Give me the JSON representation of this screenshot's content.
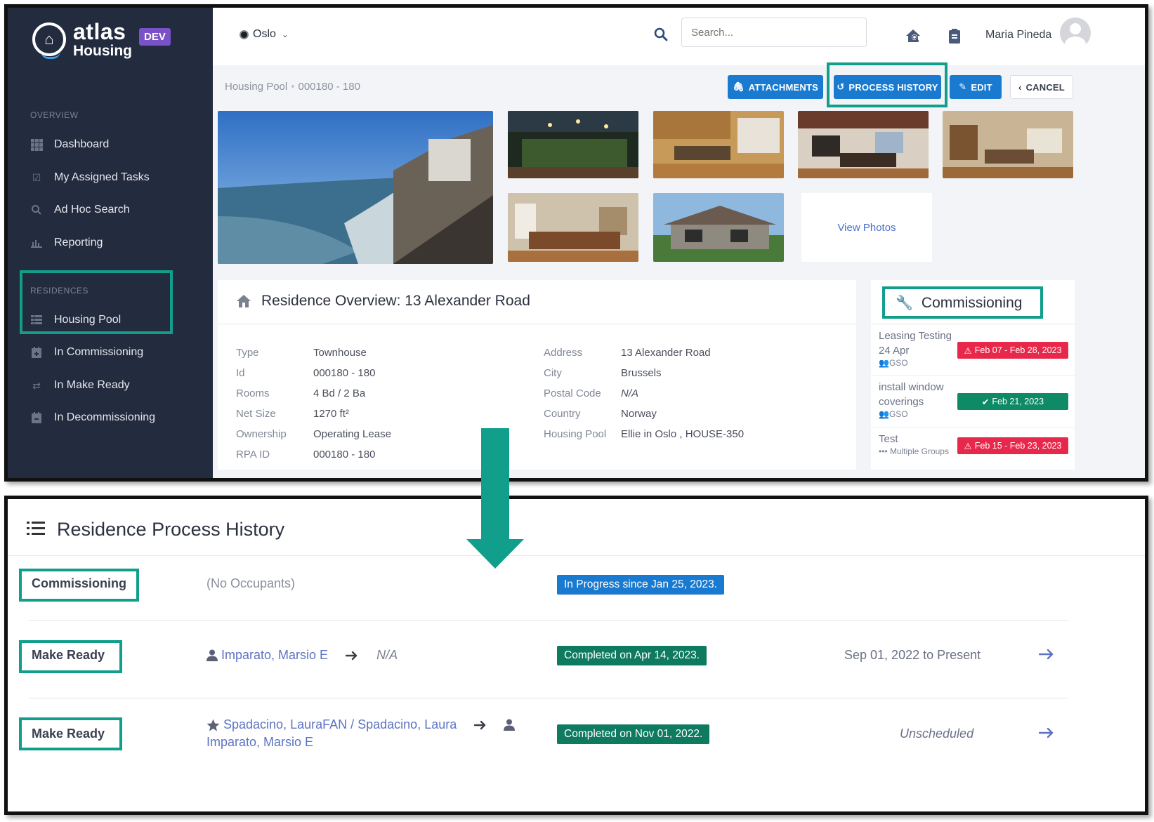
{
  "app": {
    "logo_line1": "atlas",
    "logo_line2": "Housing",
    "env_badge": "DEV"
  },
  "sidebar": {
    "overview_label": "OVERVIEW",
    "residences_label": "RESIDENCES",
    "overview_items": [
      {
        "label": "Dashboard",
        "icon": "grid-icon"
      },
      {
        "label": "My Assigned Tasks",
        "icon": "check-square-icon"
      },
      {
        "label": "Ad Hoc Search",
        "icon": "search-icon"
      },
      {
        "label": "Reporting",
        "icon": "bar-chart-icon"
      }
    ],
    "residence_items": [
      {
        "label": "Housing Pool",
        "icon": "list-icon"
      },
      {
        "label": "In Commissioning",
        "icon": "calendar-plus-icon"
      },
      {
        "label": "In Make Ready",
        "icon": "refresh-icon"
      },
      {
        "label": "In Decommissioning",
        "icon": "calendar-minus-icon"
      }
    ]
  },
  "topbar": {
    "city": "Oslo",
    "search_placeholder": "Search...",
    "user_name": "Maria Pineda"
  },
  "breadcrumb": {
    "root": "Housing Pool",
    "separator": "•",
    "current": "000180 - 180"
  },
  "actions": {
    "attachments": "ATTACHMENTS",
    "process_history": "PROCESS HISTORY",
    "edit": "EDIT",
    "cancel": "CANCEL"
  },
  "photos": {
    "view_photos": "View Photos"
  },
  "overview": {
    "title": "Residence Overview: 13 Alexander Road",
    "left": [
      {
        "key": "Type",
        "value": "Townhouse"
      },
      {
        "key": "Id",
        "value": "000180 - 180"
      },
      {
        "key": "Rooms",
        "value": "4 Bd / 2 Ba"
      },
      {
        "key": "Net Size",
        "value": "1270 ft²"
      },
      {
        "key": "Ownership",
        "value": "Operating Lease"
      },
      {
        "key": "RPA ID",
        "value": "000180 - 180"
      }
    ],
    "right": [
      {
        "key": "Address",
        "value": "13 Alexander Road"
      },
      {
        "key": "City",
        "value": "Brussels"
      },
      {
        "key": "Postal Code",
        "value": "N/A"
      },
      {
        "key": "Country",
        "value": "Norway"
      },
      {
        "key": "Housing Pool",
        "value": "Ellie in Oslo , HOUSE-350"
      }
    ]
  },
  "commissioning": {
    "title": "Commissioning",
    "items": [
      {
        "name_line1": "Leasing Testing",
        "name_line2": "24 Apr",
        "group": "GSO",
        "badge": "Feb 07 - Feb 28, 2023",
        "status": "overdue"
      },
      {
        "name_line1": "install window",
        "name_line2": "coverings",
        "group": "GSO",
        "badge": "Feb 21, 2023",
        "status": "done"
      },
      {
        "name_line1": "Test",
        "name_line2": "",
        "group": "Multiple Groups",
        "badge": "Feb 15 - Feb 23, 2023",
        "status": "overdue"
      }
    ]
  },
  "process_history": {
    "title": "Residence Process History",
    "rows": [
      {
        "stage": "Commissioning",
        "occupant_from": "(No Occupants)",
        "occupant_to": "",
        "status": "In Progress since Jan 25, 2023.",
        "period": ""
      },
      {
        "stage": "Make Ready",
        "occupant_from": "Imparato, Marsio E",
        "occupant_to": "N/A",
        "status": "Completed on Apr 14, 2023.",
        "period": "Sep 01, 2022 to Present"
      },
      {
        "stage": "Make Ready",
        "occupant_from": "Spadacino, LauraFAN / Spadacino, Laura",
        "occupant_to": "Imparato, Marsio E",
        "status": "Completed on Nov 01, 2022.",
        "period": "Unscheduled"
      }
    ]
  },
  "colors": {
    "highlight": "#119e8b",
    "sidebar_bg": "#232b3e",
    "primary_blue": "#1a7ad0",
    "overdue_red": "#e8284a",
    "done_green": "#0e8a66"
  }
}
